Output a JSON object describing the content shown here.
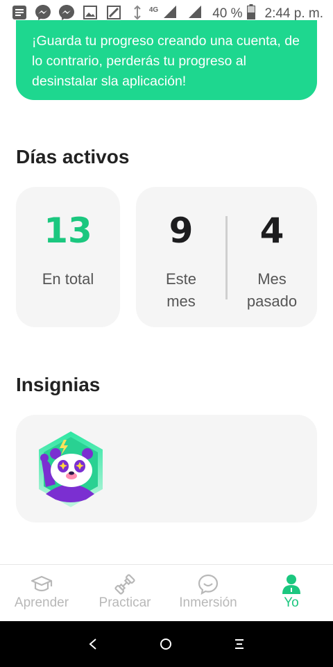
{
  "status_bar": {
    "icons_left": [
      "notes-icon",
      "messenger-icon",
      "messenger-icon",
      "image-icon",
      "sign-icon",
      "sim-arrow-icon"
    ],
    "network": "4G",
    "battery": "40 %",
    "time": "2:44 p. m."
  },
  "banner": {
    "text": "¡Guarda tu progreso creando una cuenta, de lo contrario, perderás tu progreso al desinstalar sla aplicación!",
    "color": "#1ed78f"
  },
  "active_days": {
    "title": "Días activos",
    "total": {
      "value": "13",
      "label": "En total",
      "color": "#1bc77f"
    },
    "this_month": {
      "value": "9",
      "label_line1": "Este",
      "label_line2": "mes"
    },
    "last_month": {
      "value": "4",
      "label_line1": "Mes",
      "label_line2": "pasado"
    }
  },
  "badges": {
    "title": "Insignias",
    "items": [
      {
        "icon": "panda-badge-icon"
      }
    ]
  },
  "bottom_nav": {
    "items": [
      {
        "label": "Aprender",
        "icon": "graduation-cap-icon",
        "active": false
      },
      {
        "label": "Practicar",
        "icon": "dumbbell-icon",
        "active": false
      },
      {
        "label": "Inmersión",
        "icon": "chat-bubble-icon",
        "active": false
      },
      {
        "label": "Yo",
        "icon": "user-icon",
        "active": true
      }
    ],
    "active_color": "#1bc77f",
    "inactive_color": "#b8b8b8"
  },
  "system_nav": [
    "back-icon",
    "home-icon",
    "recents-icon"
  ]
}
